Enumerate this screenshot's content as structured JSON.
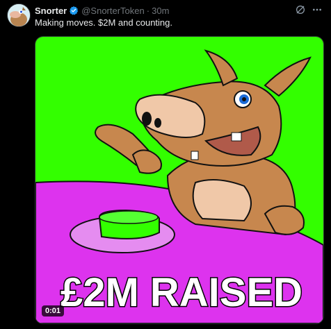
{
  "author": {
    "name": "Snorter",
    "handle": "@SnorterToken",
    "separator": "·",
    "time": "30m"
  },
  "post": {
    "text": "Making moves. $2M and counting."
  },
  "media": {
    "caption": "£2M RAISED",
    "duration": "0:01"
  },
  "icons": {
    "verified": "verified-badge-icon",
    "grok": "grok-icon",
    "more": "more-icon"
  },
  "colors": {
    "verified": "#1d9bf0",
    "background": "#000000",
    "media_green": "#33ff00",
    "table_magenta": "#dd33ee"
  }
}
